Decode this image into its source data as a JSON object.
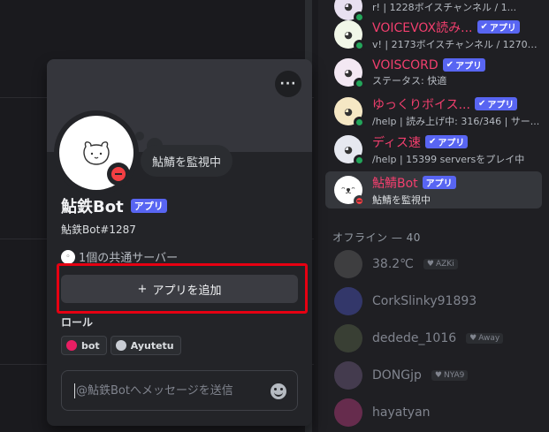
{
  "members": {
    "online": [
      {
        "name": "",
        "badge": "",
        "status": "r! | 1228ボイスチャンネル / 1..."
      },
      {
        "name": "VOICEVOX読み...",
        "badge": "アプリ",
        "status": "v! | 2173ボイスチャンネル / 12700..."
      },
      {
        "name": "VOISCORD",
        "badge": "アプリ",
        "status": "ステータス: 快適"
      },
      {
        "name": "ゆっくりボイス...",
        "badge": "アプリ",
        "status": "/help | 読み上げ中: 316/346 | サー..."
      },
      {
        "name": "ディス速",
        "badge": "アプリ",
        "status": "/help | 15399 serversをプレイ中"
      },
      {
        "name": "鮎鯖Bot",
        "badge": "アプリ",
        "status": "鮎鯖を監視中"
      }
    ],
    "offline_header": "オフライン — 40",
    "offline": [
      {
        "name": "38.2℃",
        "tag": "AZKi"
      },
      {
        "name": "CorkSlinky91893",
        "tag": ""
      },
      {
        "name": "dedede_1016",
        "tag": "Away"
      },
      {
        "name": "DONGjp",
        "tag": "NYA9"
      },
      {
        "name": "hayatyan",
        "tag": ""
      }
    ]
  },
  "profile": {
    "custom_status": "鮎鯖を監視中",
    "display_name": "鮎鉄Bot",
    "badge": "アプリ",
    "username": "鮎鉄Bot#1287",
    "mutual_servers": "1個の共通サーバー",
    "add_app_label": "アプリを追加",
    "add_app_icon": "+",
    "more_label": "···",
    "roles_title": "ロール",
    "roles": [
      {
        "name": "bot",
        "color": "#e91e63"
      },
      {
        "name": "Ayutetu",
        "color": "#c9cdd4"
      }
    ],
    "message_placeholder": "@鮎鉄Botへメッセージを送信"
  },
  "colors": {
    "highlight": "#e60012",
    "app_badge": "#5865f2",
    "dnd": "#f23f43",
    "online": "#23a55a"
  }
}
